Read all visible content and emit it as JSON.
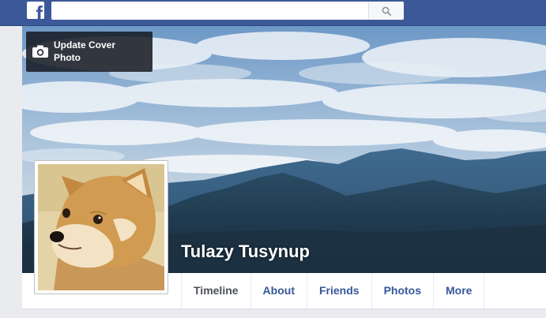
{
  "header": {
    "logo_letter": "f",
    "logo_icon": "facebook-logo-icon",
    "search_placeholder": "",
    "search_icon": "magnifier-icon",
    "brand_color": "#3b5998"
  },
  "cover": {
    "update_button_label": "Update Cover Photo",
    "camera_icon": "camera-icon",
    "image_subject": "mountain landscape with clouds"
  },
  "profile": {
    "name": "Tulazy Tusynup",
    "picture_subject": "shiba inu dog"
  },
  "nav": {
    "tabs": [
      {
        "label": "Timeline",
        "active": true
      },
      {
        "label": "About",
        "active": false
      },
      {
        "label": "Friends",
        "active": false
      },
      {
        "label": "Photos",
        "active": false
      },
      {
        "label": "More",
        "active": false
      }
    ],
    "link_color": "#365899"
  }
}
